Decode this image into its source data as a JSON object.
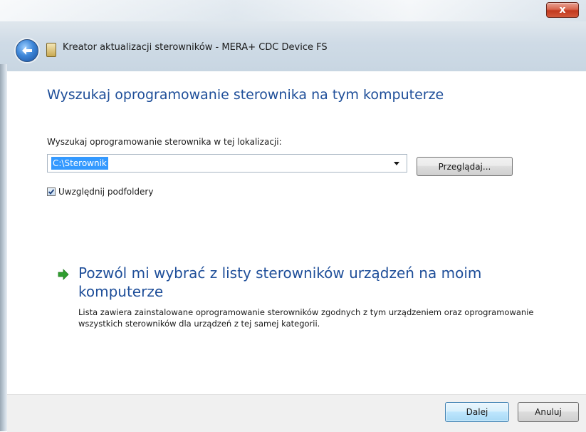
{
  "window": {
    "title": "Kreator aktualizacji sterowników - MERA+ CDC Device FS",
    "close_label": "x"
  },
  "page": {
    "heading": "Wyszukaj oprogramowanie sterownika na tym komputerze",
    "location_label": "Wyszukaj oprogramowanie sterownika w tej lokalizacji:",
    "path_value": "C:\\Sterownik",
    "browse_label": "Przeglądaj...",
    "include_subfolders_label": "Uwzględnij podfoldery",
    "include_subfolders_checked": true
  },
  "option": {
    "icon": "green-arrow-icon",
    "title": "Pozwól mi wybrać z listy sterowników urządzeń na moim komputerze",
    "description": "Lista zawiera zainstalowane oprogramowanie sterowników zgodnych z tym urządzeniem oraz oprogramowanie wszystkich sterowników dla urządzeń z tej samej kategorii."
  },
  "footer": {
    "next_label": "Dalej",
    "cancel_label": "Anuluj"
  },
  "colors": {
    "heading": "#1e4e99",
    "selection": "#3399ff",
    "arrow": "#2f9e2f"
  }
}
